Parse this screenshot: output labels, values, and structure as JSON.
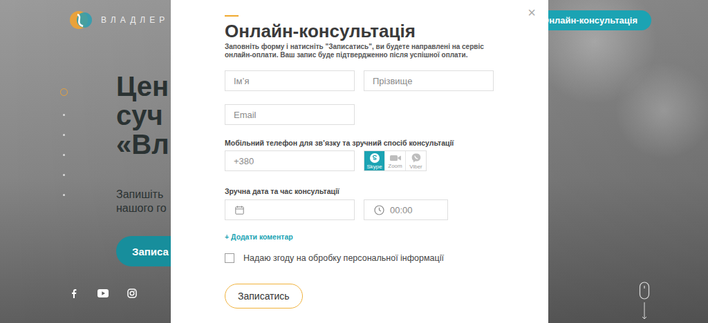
{
  "header": {
    "logo": "ВЛАДЛЕР",
    "button": "Онлайн-консультація"
  },
  "hero": {
    "title_lines": [
      "Цен",
      "суч",
      "«Вл"
    ],
    "subtitle_lines": [
      "Запишіть",
      "нашого го"
    ],
    "button": "Записа"
  },
  "modal": {
    "title": "Онлайн-консультація",
    "close": "×",
    "intro_lines": [
      "Заповніть форму і натисніть \"Записатись\", ви будете направлені на сервіс",
      "онлайн-оплати. Ваш запис буде підтвердженно після успішної оплати."
    ],
    "first_name": {
      "placeholder": "Ім’я"
    },
    "last_name": {
      "placeholder": "Прізвище"
    },
    "email": {
      "placeholder": "Email"
    },
    "phone_label": "Мобільний телефон для зв’язку та зручний спосіб консультації",
    "phone": {
      "placeholder": "+380"
    },
    "methods": [
      {
        "label": "Skype",
        "kind": "skype",
        "selected": true
      },
      {
        "label": "Zoom",
        "kind": "zoom",
        "selected": false
      },
      {
        "label": "Viber",
        "kind": "viber",
        "selected": false
      }
    ],
    "datetime_label": "Зручна дата та час консультації",
    "date": {
      "placeholder": ""
    },
    "time": {
      "placeholder": "00:00"
    },
    "comment_link": "+ Додати коментар",
    "consent": {
      "label": "Надаю згоду на обробку персональної інформації",
      "checked": false
    },
    "submit": "Записатись"
  }
}
